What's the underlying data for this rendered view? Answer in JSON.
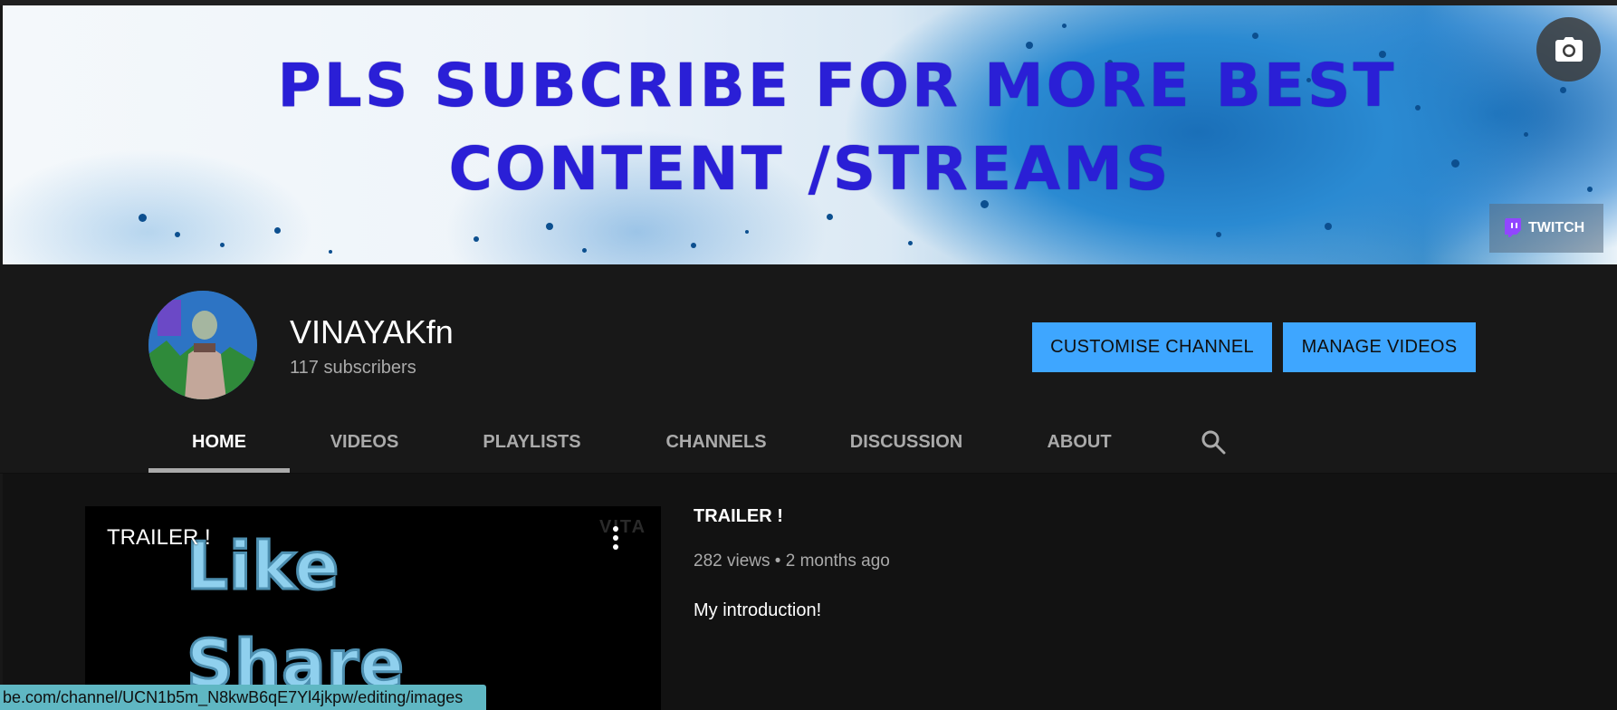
{
  "banner": {
    "line1": "PLS SUBCRIBE FOR  MORE BEST",
    "line2": "CONTENT /STREAMS",
    "camera_icon": "camera-icon",
    "twitch_label": "TWITCH",
    "twitch_icon": "twitch-icon"
  },
  "channel": {
    "name": "VINAYAKfn",
    "subscribers": "117 subscribers"
  },
  "buttons": {
    "customise": "CUSTOMISE CHANNEL",
    "manage": "MANAGE VIDEOS"
  },
  "tabs": [
    {
      "label": "HOME",
      "active": true
    },
    {
      "label": "VIDEOS"
    },
    {
      "label": "PLAYLISTS"
    },
    {
      "label": "CHANNELS"
    },
    {
      "label": "DISCUSSION"
    },
    {
      "label": "ABOUT"
    }
  ],
  "search_icon": "search-icon",
  "featured_video": {
    "thumb_title": "TRAILER !",
    "thumb_word1": "Like",
    "thumb_word2": "Share",
    "thumb_watermark": "VITA",
    "title": "TRAILER !",
    "views": "282 views",
    "age": "2 months ago",
    "description": "My introduction!"
  },
  "status_bar": {
    "url": "be.com/channel/UCN1b5m_N8kwB6qE7Yl4jkpw/editing/images"
  },
  "colors": {
    "accent": "#3ea6ff",
    "background": "#181818",
    "banner_text": "#2a1fd6",
    "status_bar": "#5fb7c3"
  }
}
